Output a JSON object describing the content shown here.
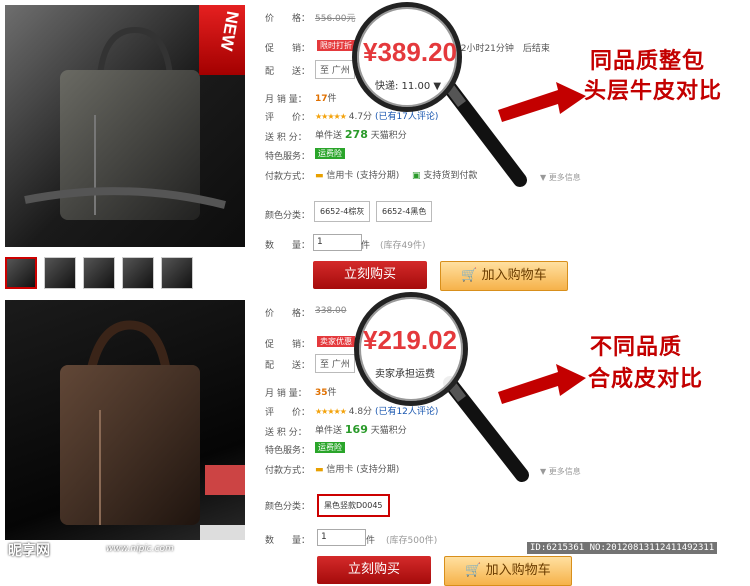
{
  "product1": {
    "price_label": "价　　格：",
    "original_price": "556.00元",
    "promo_label": "促　　销：",
    "promo_tag": "限时打折",
    "promo_time": "12小时21分钟　后结束",
    "shipping_label": "配　　送：",
    "shipping_city": "至 广州",
    "monthly_sales_label": "月 销 量：",
    "monthly_sales": "17",
    "monthly_sales_unit": "件",
    "rating_label": "评　　价：",
    "rating_stars": "★★★★★",
    "rating_score": "4.7分",
    "review_count": "(已有17人评论)",
    "points_label": "送 积 分：",
    "points_prefix": "单件送",
    "points": "278",
    "points_suffix": "天猫积分",
    "service_label": "特色服务：",
    "service_badge": "运费险",
    "payment_label": "付款方式：",
    "pay_credit": "信用卡 (支持分期)",
    "pay_cod": "支持货到付款",
    "more_info": "更多信息",
    "color_label": "颜色分类：",
    "colors": [
      "6652-4棕灰",
      "6652-4黑色"
    ],
    "qty_label": "数　　量：",
    "qty": "1",
    "qty_unit": "件",
    "stock": "(库存49件)",
    "buy_now": "立刻购买",
    "add_cart": "加入购物车",
    "lens_price": "¥389.20",
    "lens_sub": "快递: 11.00 ▼",
    "annotation_line1": "同品质整包",
    "annotation_line2": "头层牛皮对比",
    "photo_ribbon": "NEW"
  },
  "product2": {
    "price_label": "价　　格：",
    "original_price": "338.00",
    "promo_label": "促　　销：",
    "promo_tag": "卖家优惠",
    "shipping_label": "配　　送：",
    "shipping_city": "至 广州",
    "monthly_sales_label": "月 销 量：",
    "monthly_sales": "35",
    "monthly_sales_unit": "件",
    "rating_label": "评　　价：",
    "rating_stars": "★★★★★",
    "rating_score": "4.8分",
    "review_count": "(已有12人评论)",
    "points_label": "送 积 分：",
    "points_prefix": "单件送",
    "points": "169",
    "points_suffix": "天猫积分",
    "service_label": "特色服务：",
    "service_badge": "运费险",
    "payment_label": "付款方式：",
    "pay_credit": "信用卡 (支持分期)",
    "more_info": "更多信息",
    "color_label": "颜色分类：",
    "colors": [
      "黑色竖款D0045"
    ],
    "qty_label": "数　　量：",
    "qty": "1",
    "qty_unit": "件",
    "stock": "(库存500件)",
    "buy_now": "立刻购买",
    "add_cart": "加入购物车",
    "lens_price": "¥219.02",
    "lens_sub": "卖家承担运费",
    "annotation_line1": "不同品质",
    "annotation_line2": "合成皮对比"
  },
  "watermark": {
    "logo": "昵享网",
    "url": "www.nipic.com",
    "id": "ID:6215361 NO:20120813112411492311"
  },
  "colors": {
    "accent_red": "#e4393c",
    "annotation_red": "#c30000",
    "points_green": "#2a9a2a",
    "cart_orange": "#f6b24a"
  }
}
